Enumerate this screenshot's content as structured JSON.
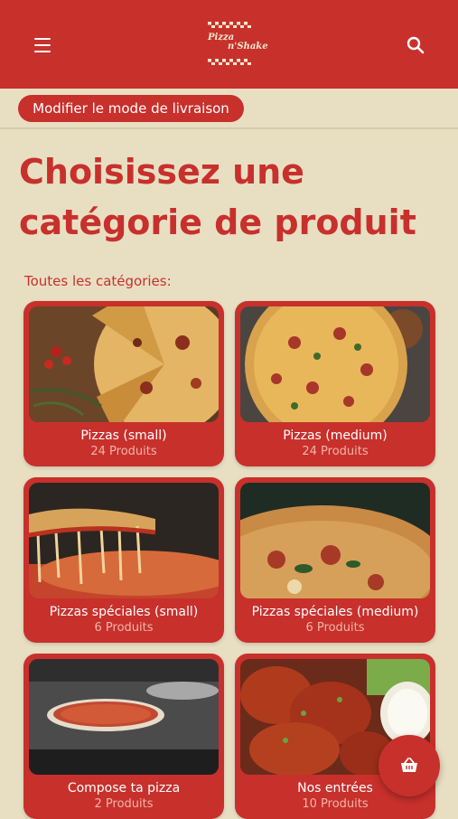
{
  "header": {
    "logo_line1": "Pizza",
    "logo_line2": "n'Shake",
    "menu_icon": "hamburger-menu-icon",
    "search_icon": "search-icon"
  },
  "delivery_button": "Modifier le mode de livraison",
  "page_title": "Choisissez une catégorie de produit",
  "section_label": "Toutes les catégories:",
  "categories": [
    {
      "title": "Pizzas (small)",
      "count": "24 Produits"
    },
    {
      "title": "Pizzas (medium)",
      "count": "24 Produits"
    },
    {
      "title": "Pizzas spéciales (small)",
      "count": "6 Produits"
    },
    {
      "title": "Pizzas spéciales (medium)",
      "count": "6 Produits"
    },
    {
      "title": "Compose ta pizza",
      "count": "2 Produits"
    },
    {
      "title": "Nos entrées",
      "count": "10 Produits"
    }
  ],
  "cart_icon": "basket-icon",
  "colors": {
    "primary": "#c8302c",
    "background": "#e8dfc3",
    "muted_text": "#f0b4a9"
  }
}
